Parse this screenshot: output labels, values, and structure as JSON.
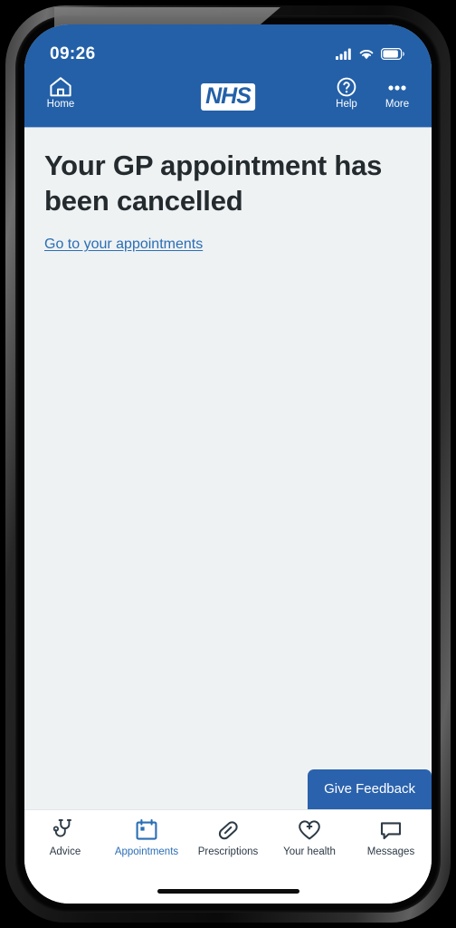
{
  "status_bar": {
    "time": "09:26",
    "icons": [
      "cellular-signal-icon",
      "wifi-icon",
      "battery-icon"
    ]
  },
  "header": {
    "home_label": "Home",
    "home_icon": "home-icon",
    "logo_text": "NHS",
    "help_label": "Help",
    "help_icon": "question-mark-circle-icon",
    "more_label": "More",
    "more_icon": "ellipsis-icon"
  },
  "main": {
    "title": "Your GP appointment has been cancelled",
    "link_label": "Go to your appointments"
  },
  "feedback": {
    "label": "Give Feedback"
  },
  "tabbar": {
    "items": [
      {
        "label": "Advice",
        "icon": "stethoscope-icon",
        "active": false
      },
      {
        "label": "Appointments",
        "icon": "calendar-icon",
        "active": true
      },
      {
        "label": "Prescriptions",
        "icon": "pill-capsule-icon",
        "active": false
      },
      {
        "label": "Your health",
        "icon": "heart-plus-icon",
        "active": false
      },
      {
        "label": "Messages",
        "icon": "speech-bubble-icon",
        "active": false
      }
    ]
  },
  "colors": {
    "nhs_blue": "#2360a8",
    "accent_link": "#2a6eb5",
    "page_bg": "#eff2f3",
    "text_dark": "#242b2e"
  }
}
